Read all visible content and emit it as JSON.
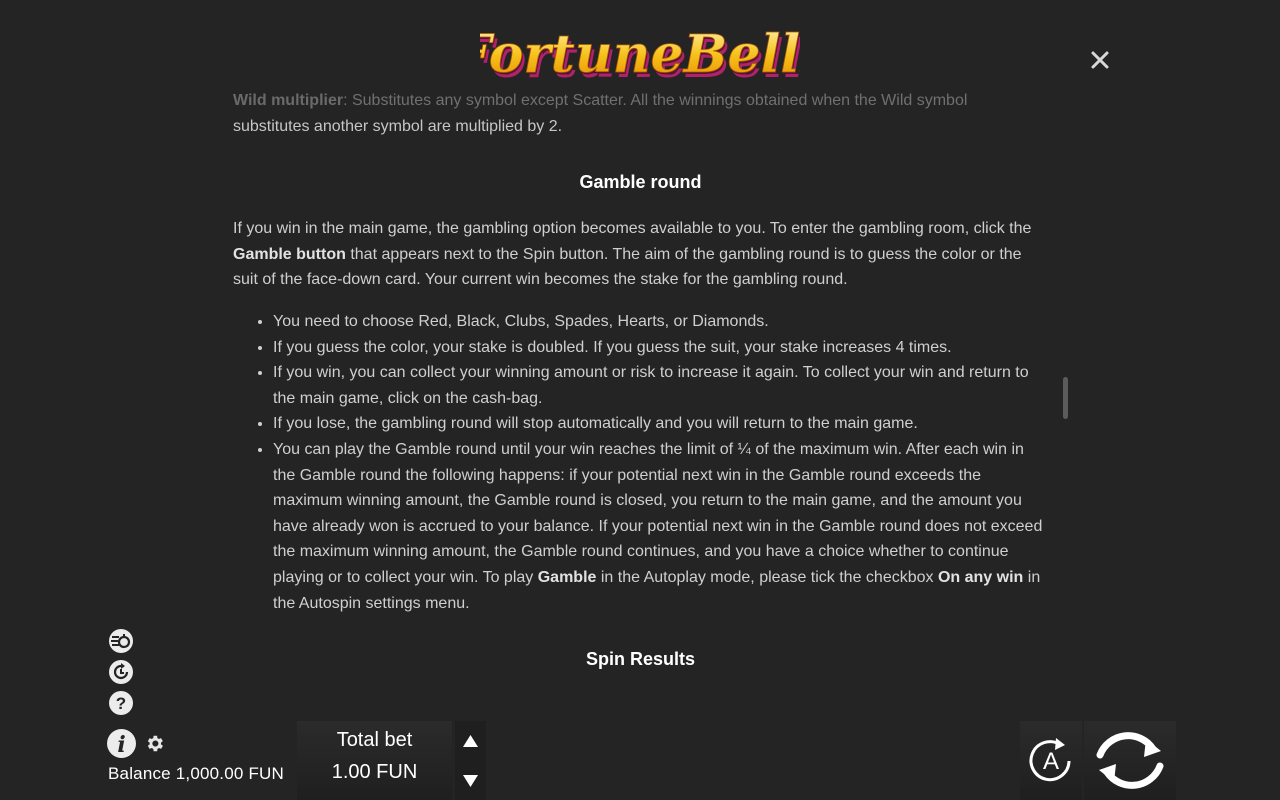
{
  "app": {
    "logo_text": "FortuneBells",
    "close_icon": "close-icon"
  },
  "rules": {
    "faded_line_prefix": "Wild multiplier",
    "faded_line_text": ": Substitutes any symbol except Scatter. All the winnings obtained when the Wild symbol",
    "faded_line_end": "substitutes another symbol are multiplied by 2.",
    "gamble_heading": "Gamble round",
    "intro_part1": "If you win in the main game, the gambling option becomes available to you. To enter the gambling room, click the ",
    "intro_bold": "Gamble button",
    "intro_part2": " that appears next to the Spin button. The aim of the gambling round is to guess the color or the suit of the face-down card. Your current win becomes the stake for the gambling round.",
    "bullets": [
      "You need to choose Red, Black, Clubs, Spades, Hearts, or Diamonds.",
      "If you guess the color, your stake is doubled. If you guess the suit, your stake increases 4 times.",
      "If you win, you can collect your winning amount or risk to increase it again. To collect your win and return to the main game, click on the cash-bag.",
      "If you lose, the gambling round will stop automatically and you will return to the main game."
    ],
    "last_bullet_part1": "You can play the Gamble round until your win reaches the limit of ¼ of the maximum win. After each win in the Gamble round the following happens: if your potential next win in the Gamble round exceeds the maximum winning amount, the Gamble round is closed, you return to the main game, and the amount you have already won is accrued to your balance. If your potential next win in the Gamble round does not exceed the maximum winning amount, the Gamble round continues, and you have a choice whether to continue playing or to collect your win. To play ",
    "last_bullet_bold1": "Gamble",
    "last_bullet_part2": " in the Autoplay mode, please tick the checkbox ",
    "last_bullet_bold2": "On any win",
    "last_bullet_part3": " in the Autospin settings menu.",
    "spin_results_heading": "Spin Results"
  },
  "sidebar": {
    "icons": [
      "turbo-icon",
      "history-icon",
      "help-icon",
      "info-icon",
      "gear-icon"
    ]
  },
  "footer": {
    "balance": "Balance 1,000.00 FUN",
    "bet_label": "Total bet",
    "bet_value": "1.00 FUN",
    "autospin_letter": "A"
  },
  "colors": {
    "background": "#242424",
    "text": "#cfcfcf",
    "heading": "#ffffff",
    "logo_gold": "#f5b400",
    "logo_pink": "#d0307a"
  }
}
